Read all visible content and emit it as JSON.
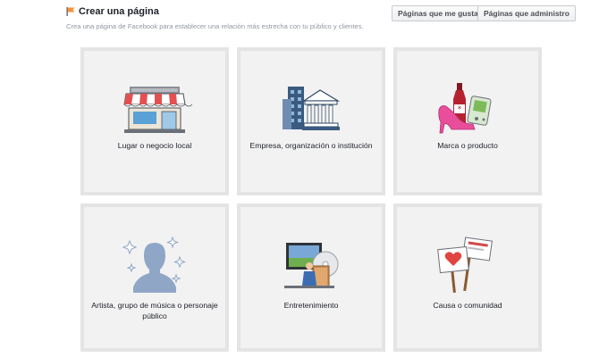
{
  "header": {
    "title": "Crear una página",
    "liked_pages_label": "Páginas que me gustan",
    "admin_pages_label": "Páginas que administro"
  },
  "subtitle": "Crea una página de Facebook para establecer una relación más estrecha con tu público y clientes.",
  "categories": [
    {
      "label": "Lugar o negocio local",
      "icon": "storefront-icon"
    },
    {
      "label": "Empresa, organización o institución",
      "icon": "company-buildings-icon"
    },
    {
      "label": "Marca o producto",
      "icon": "brand-product-icon"
    },
    {
      "label": "Artista, grupo de música o personaje público",
      "icon": "artist-silhouette-icon"
    },
    {
      "label": "Entretenimiento",
      "icon": "entertainment-icon"
    },
    {
      "label": "Causa o comunidad",
      "icon": "cause-signs-icon"
    }
  ],
  "colors": {
    "card_bg": "#f2f2f2",
    "card_border": "#e4e4e4",
    "flag_orange": "#f7923a"
  }
}
